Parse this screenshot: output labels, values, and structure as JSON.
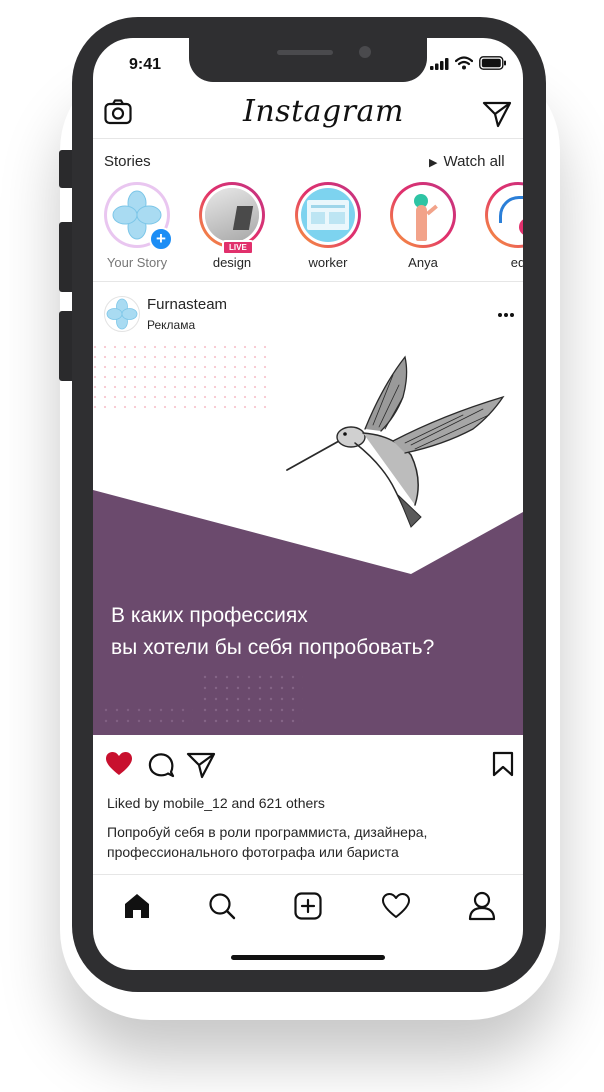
{
  "status_bar": {
    "time": "9:41"
  },
  "header": {
    "logo": "Instagram",
    "left_icon": "camera-icon",
    "right_icon": "direct-message-icon"
  },
  "stories": {
    "title": "Stories",
    "watch_all": "Watch all",
    "items": [
      {
        "label": "Your Story",
        "add_badge": "+"
      },
      {
        "label": "design",
        "badge": "LIVE"
      },
      {
        "label": "worker"
      },
      {
        "label": "Anya"
      },
      {
        "label": "ed"
      }
    ]
  },
  "post": {
    "username": "Furnasteam",
    "subtitle": "Реклама",
    "menu_icon": "more-icon",
    "image_text_line1": "В каких профессиях",
    "image_text_line2": "вы хотели бы себя попробовать?",
    "likes_text": "Liked by mobile_12 and 621 others",
    "caption_line1": "Попробуй себя в роли программиста, дизайнера,",
    "caption_line2": "профессионального фотографа или бариста",
    "liked": true
  },
  "tab_bar": {
    "items": [
      "home-icon",
      "search-icon",
      "new-post-icon",
      "activity-icon",
      "profile-icon"
    ]
  },
  "colors": {
    "accent_like": "#c8102e",
    "ad_purple": "#6b4a6d",
    "live_badge": "#e1306c",
    "story_ring": "#e1306c"
  }
}
